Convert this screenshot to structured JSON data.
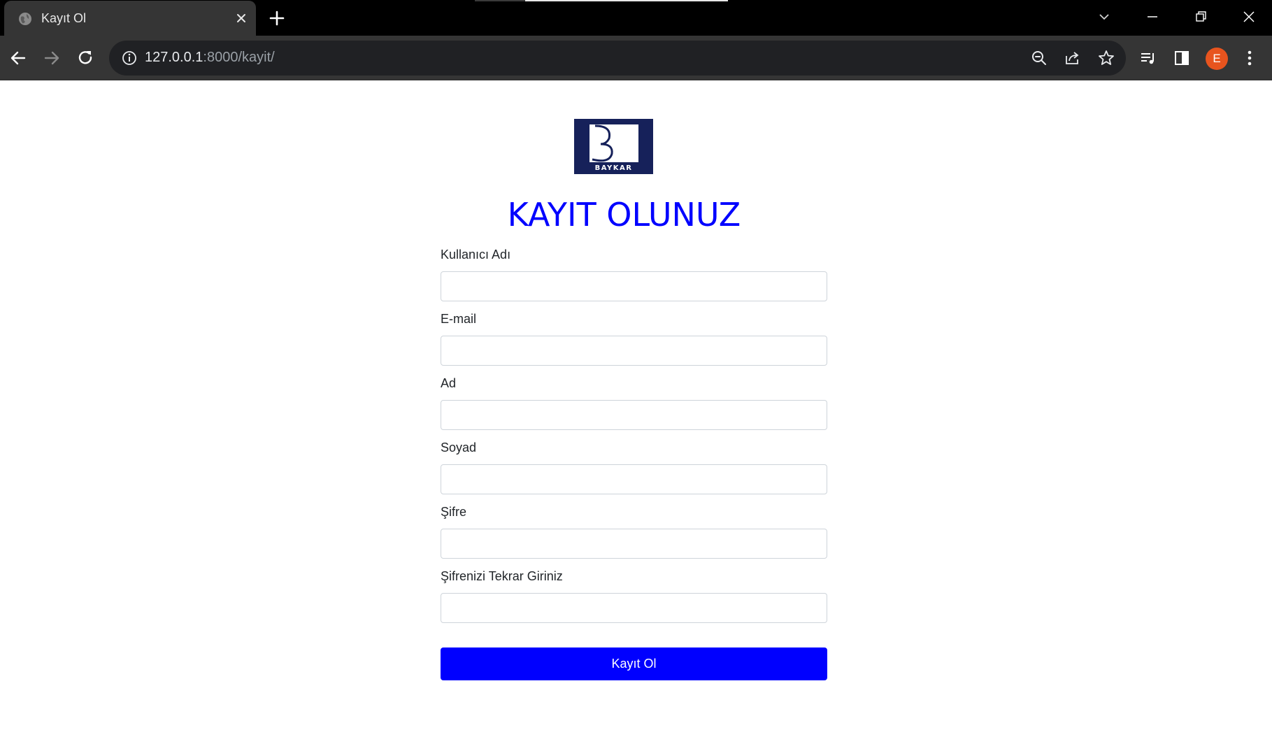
{
  "browser": {
    "tab_title": "Kayıt Ol",
    "url_host": "127.0.0.1",
    "url_path": ":8000/kayit/",
    "profile_initial": "E",
    "accent_colors": {
      "tab_bar": "#000000",
      "toolbar": "#353535",
      "omnibox": "#202124",
      "avatar": "#e8541e"
    }
  },
  "page": {
    "logo_text": "BAYKAR",
    "heading": "KAYIT OLUNUZ",
    "fields": [
      {
        "label": "Kullanıcı Adı",
        "value": ""
      },
      {
        "label": "E-mail",
        "value": ""
      },
      {
        "label": "Ad",
        "value": ""
      },
      {
        "label": "Soyad",
        "value": ""
      },
      {
        "label": "Şifre",
        "value": ""
      },
      {
        "label": "Şifrenizi Tekrar Giriniz",
        "value": ""
      }
    ],
    "submit_label": "Kayıt Ol",
    "colors": {
      "heading": "#0000ff",
      "button": "#0000ff",
      "logo_bg": "#16215a"
    }
  }
}
